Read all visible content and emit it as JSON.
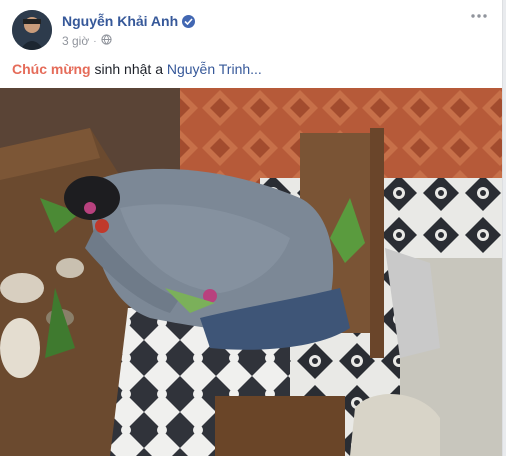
{
  "post": {
    "author": "Nguyễn Khải Anh",
    "timestamp": "3 giờ",
    "text_highlight": "Chúc mừng",
    "text_middle": " sinh nhật a ",
    "text_tag": "Nguyễn Trinh...",
    "verified_icon": "verified-badge-icon",
    "privacy_icon": "globe-icon",
    "more_icon": "more-options-icon"
  },
  "colors": {
    "link": "#365899",
    "highlight": "#e56b59",
    "meta": "#90949c",
    "verified": "#4267b2"
  }
}
